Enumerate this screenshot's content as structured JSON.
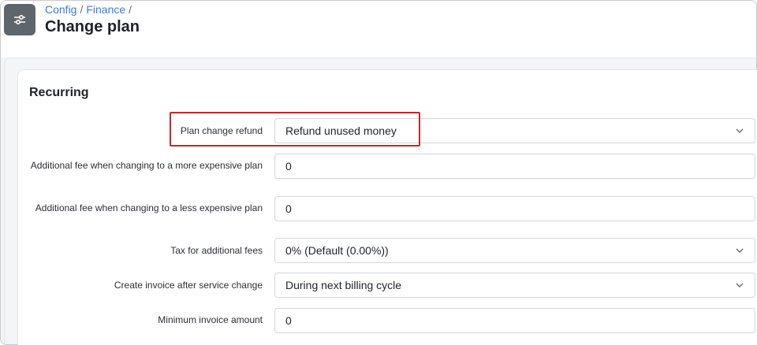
{
  "breadcrumb": {
    "items": [
      "Config",
      "Finance"
    ],
    "separator": "/"
  },
  "page": {
    "title": "Change plan",
    "icon": "sliders-icon"
  },
  "section": {
    "title": "Recurring"
  },
  "fields": [
    {
      "label": "Plan change refund",
      "value": "Refund unused money",
      "type": "select"
    },
    {
      "label": "Additional fee when changing to a more expensive plan",
      "value": "0",
      "type": "input"
    },
    {
      "label": "Additional fee when changing to a less expensive plan",
      "value": "0",
      "type": "input"
    },
    {
      "label": "Tax for additional fees",
      "value": "0% (Default (0.00%))",
      "type": "select"
    },
    {
      "label": "Create invoice after service change",
      "value": "During next billing cycle",
      "type": "select"
    },
    {
      "label": "Minimum invoice amount",
      "value": "0",
      "type": "input"
    }
  ],
  "colors": {
    "link": "#3b7ddd",
    "highlight": "#c6262e",
    "icon_bg": "#5f656d"
  }
}
